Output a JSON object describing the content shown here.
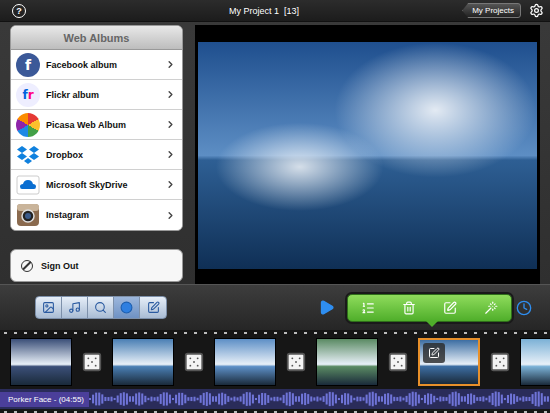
{
  "window": {
    "title": "My Project 1",
    "count": "[13]",
    "help": "?"
  },
  "header_button": "My Projects",
  "sidebar": {
    "title": "Web Albums",
    "items": [
      {
        "label": "Facebook album",
        "kind": "facebook",
        "logo": "f"
      },
      {
        "label": "Flickr album",
        "kind": "flickr",
        "logo": "fr"
      },
      {
        "label": "Picasa Web Album",
        "kind": "picasa",
        "logo": ""
      },
      {
        "label": "Dropbox",
        "kind": "dropbox",
        "logo": ""
      },
      {
        "label": "Microsoft SkyDrive",
        "kind": "skydrive",
        "logo": ""
      },
      {
        "label": "Instagram",
        "kind": "instagram",
        "logo": ""
      }
    ],
    "sign_out": "Sign Out"
  },
  "media_tabs": [
    {
      "kind": "photos",
      "selected": false
    },
    {
      "kind": "music",
      "selected": false
    },
    {
      "kind": "search",
      "selected": false
    },
    {
      "kind": "web",
      "selected": true
    },
    {
      "kind": "text",
      "selected": false
    }
  ],
  "timeline": {
    "clips": [
      {
        "kind": "photo",
        "color": "#3b4f78",
        "selected": false
      },
      {
        "kind": "transition",
        "selected": false
      },
      {
        "kind": "photo",
        "color": "#4a7fb4",
        "selected": false
      },
      {
        "kind": "transition",
        "selected": false
      },
      {
        "kind": "photo",
        "color": "#5d8fc6",
        "selected": false
      },
      {
        "kind": "transition",
        "selected": false
      },
      {
        "kind": "photo",
        "color": "#5a8a63",
        "selected": false
      },
      {
        "kind": "transition",
        "selected": false
      },
      {
        "kind": "photo",
        "color": "#3d6ea3",
        "selected": true
      },
      {
        "kind": "transition",
        "selected": false
      },
      {
        "kind": "photo",
        "color": "#7bb1d6",
        "selected": false
      }
    ]
  },
  "audio": {
    "label": "Porker Face - (04:55)"
  }
}
